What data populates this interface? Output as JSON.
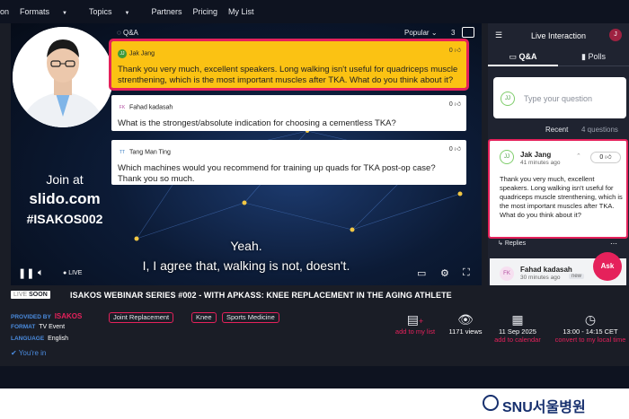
{
  "nav": {
    "items": [
      "on",
      "Formats",
      "Topics",
      "Partners",
      "Pricing",
      "My List"
    ]
  },
  "video": {
    "join": {
      "line1": "Join at",
      "line2": "slido.com",
      "line3": "#ISAKOS002"
    },
    "subtitles": {
      "line1": "Yeah.",
      "line2": "I, I agree that, walking is not, doesn't."
    },
    "qa_label": "Q&A",
    "sort": "Popular",
    "count": "3",
    "live": "LIVE",
    "questions": [
      {
        "initials": "JJ",
        "author": "Jak Jang",
        "likes": "0",
        "text": "Thank you very much, excellent speakers. Long walking isn't useful for quadriceps muscle strenthening, which is the most important muscles after TKA. What do you think about it?"
      },
      {
        "initials": "FK",
        "author": "Fahad kadasah",
        "likes": "0",
        "text": "What is the strongest/absolute indication for choosing a cementless TKA?"
      },
      {
        "initials": "TT",
        "author": "Tang Man Ting",
        "likes": "0",
        "text": "Which machines would you recommend for training up quads for TKA post-op case? Thank you so much."
      }
    ]
  },
  "panel": {
    "title": "Live Interaction",
    "user_initial": "J",
    "tabs": {
      "qa": "Q&A",
      "polls": "Polls"
    },
    "input": {
      "initials": "JJ",
      "placeholder": "Type your question"
    },
    "recent": "Recent",
    "question_count": "4 questions",
    "q1": {
      "initials": "JJ",
      "author": "Jak Jang",
      "time": "41 minutes ago",
      "likes": "0",
      "text": "Thank you very much, excellent speakers. Long walking isn't useful for quadriceps muscle strenthening, which is the most important muscles after TKA. What do you think about it?",
      "replies": "Replies"
    },
    "q2": {
      "initials": "FK",
      "author": "Fahad kadasah",
      "time": "30 minutes ago",
      "tag": "new"
    },
    "ask": "Ask"
  },
  "webinar": {
    "badge_live": "LIVE",
    "badge_soon": "SOON",
    "title": "ISAKOS WEBINAR SERIES #002 - WITH APKASS: KNEE REPLACEMENT IN THE AGING ATHLETE",
    "provided_by_label": "PROVIDED BY",
    "provided_by": "ISAKOS",
    "format_label": "FORMAT",
    "format": "TV Event",
    "language_label": "LANGUAGE",
    "language": "English",
    "youre_in": "You're in",
    "tags": [
      "Joint Replacement",
      "Knee",
      "Sports Medicine"
    ],
    "actions": {
      "add_list": "add to my list",
      "views": "1171 views",
      "date": "11 Sep 2025",
      "add_calendar": "add to calendar",
      "time": "13:00 - 14:15 CET",
      "convert": "convert to my local time"
    }
  },
  "watermark": "SNU서울병원"
}
